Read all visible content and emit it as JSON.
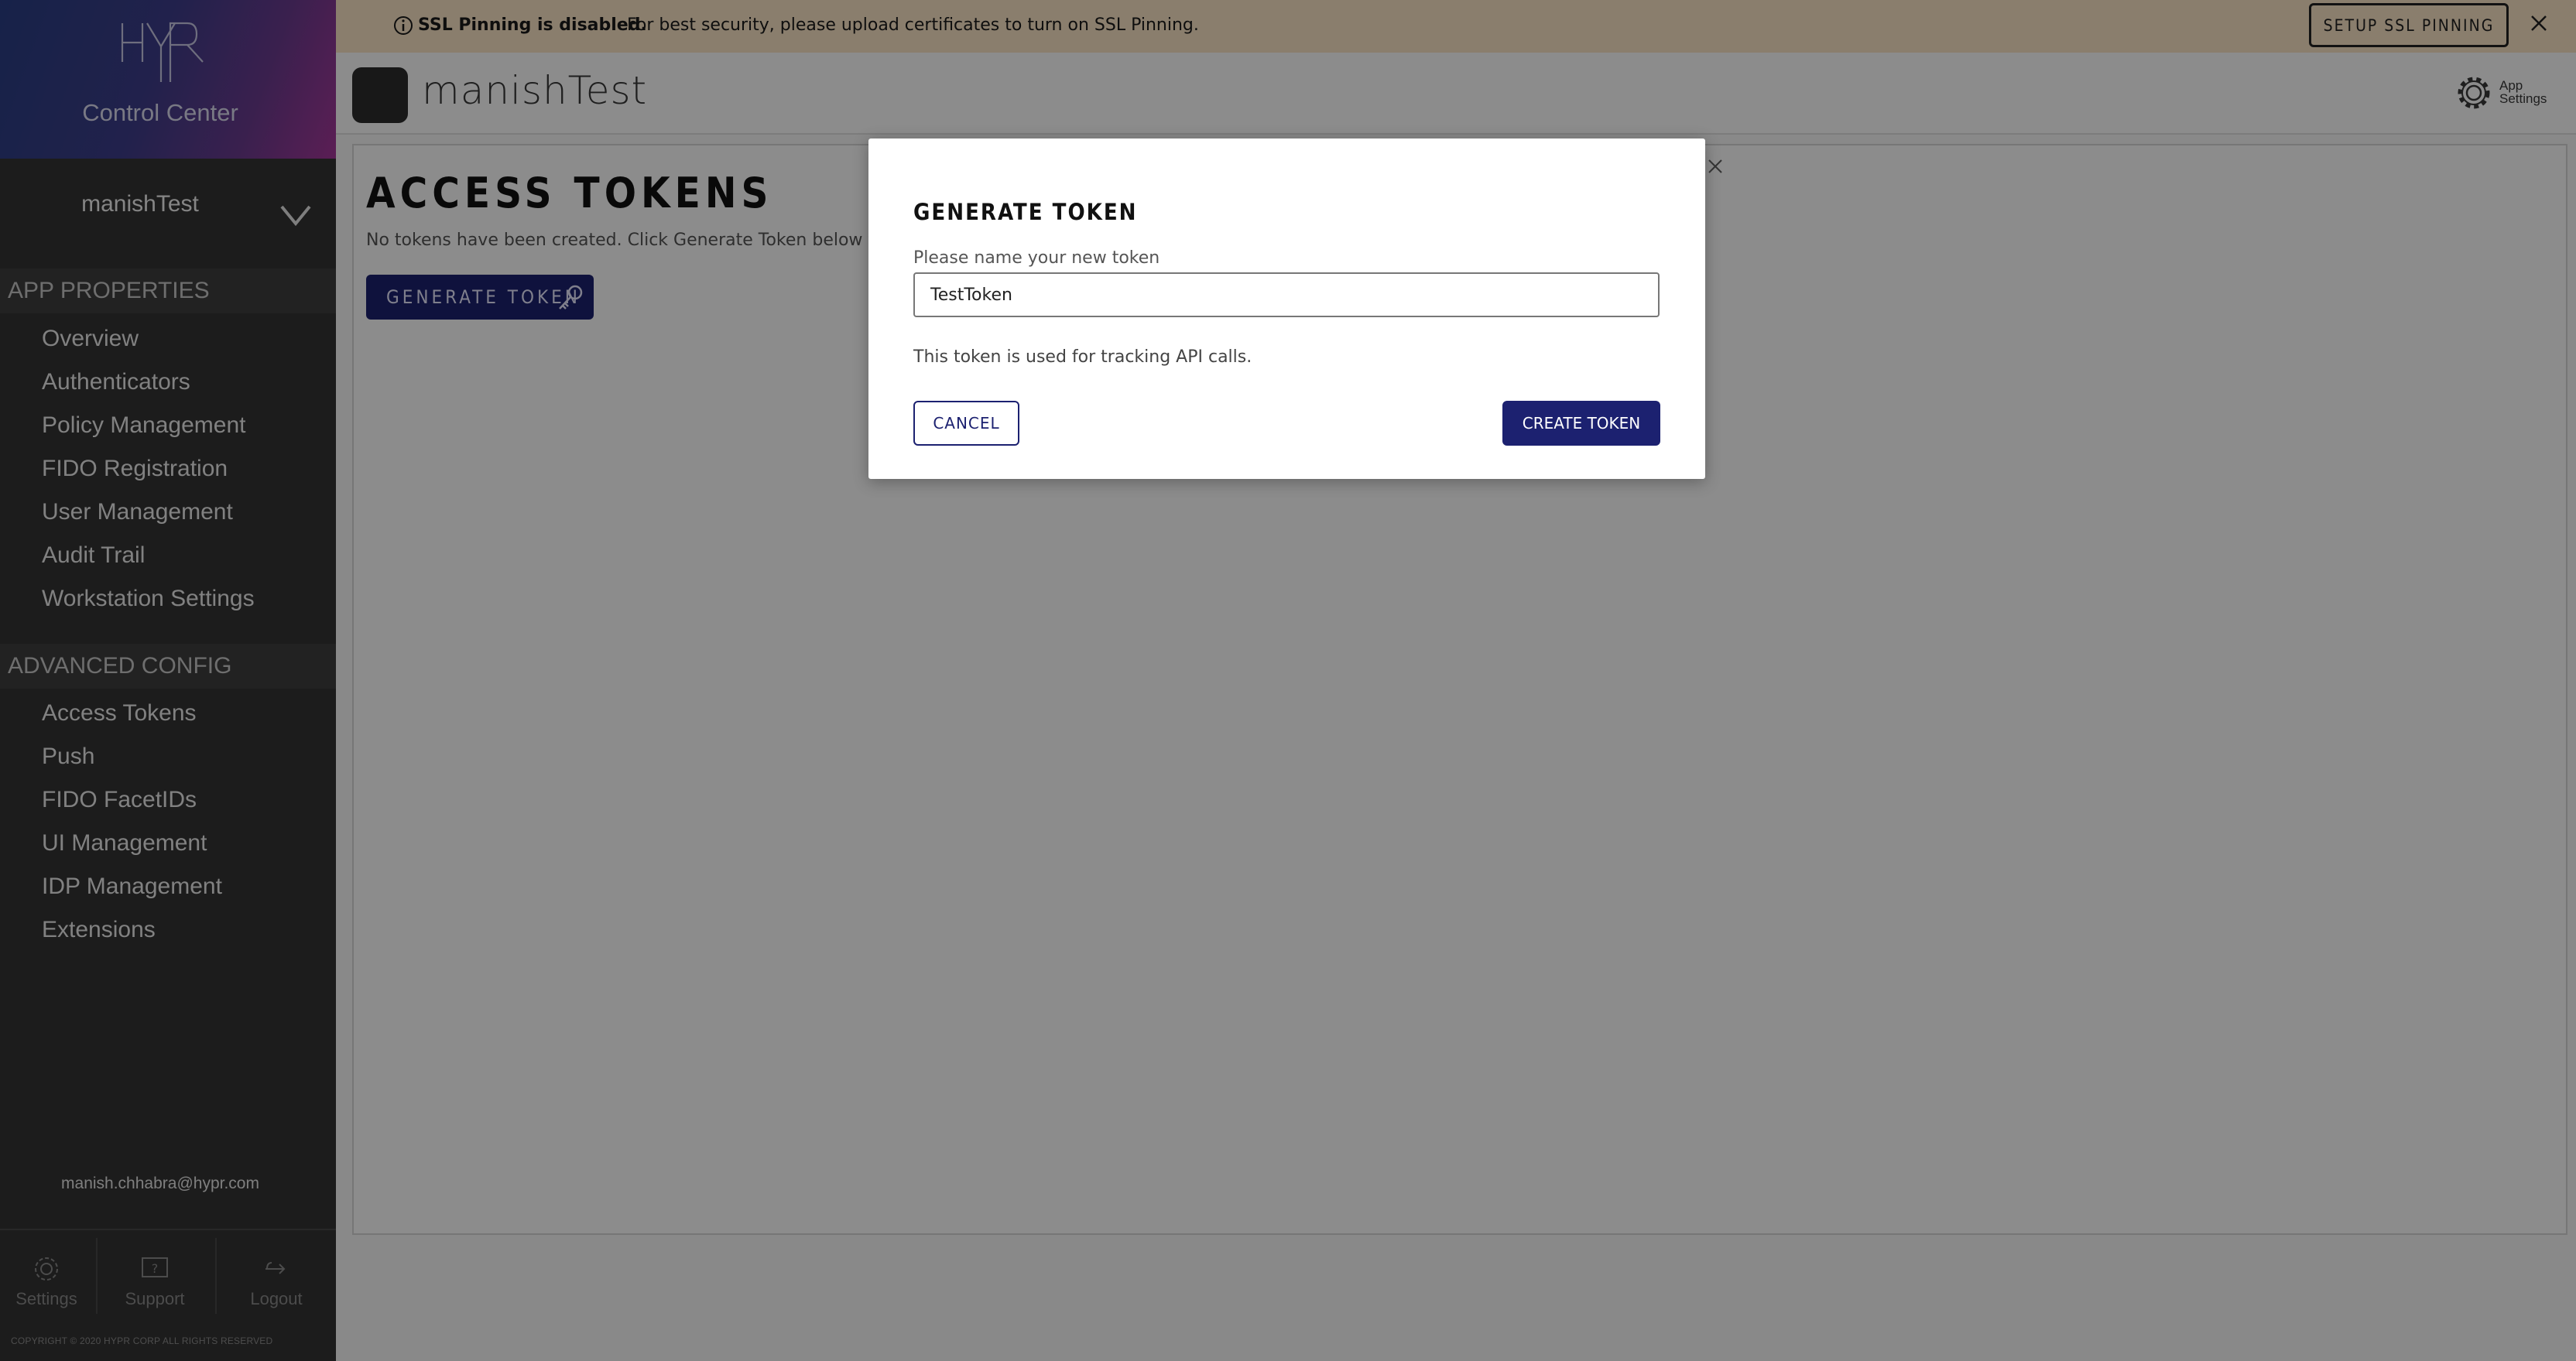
{
  "sidebar": {
    "brand_logo": "HYPR",
    "brand_title": "Control Center",
    "current_app": "manishTest",
    "sections": [
      {
        "title": "APP PROPERTIES",
        "items": [
          "Overview",
          "Authenticators",
          "Policy Management",
          "FIDO Registration",
          "User Management",
          "Audit Trail",
          "Workstation Settings"
        ]
      },
      {
        "title": "ADVANCED CONFIG",
        "items": [
          "Access Tokens",
          "Push",
          "FIDO FacetIDs",
          "UI Management",
          "IDP Management",
          "Extensions"
        ]
      }
    ],
    "user_email": "manish.chhabra@hypr.com",
    "footer": {
      "settings_label": "Settings",
      "support_label": "Support",
      "logout_label": "Logout"
    },
    "copyright": "COPYRIGHT © 2020 HYPR CORP ALL RIGHTS RESERVED"
  },
  "banner": {
    "bold_text": "SSL Pinning is disabled.",
    "message": "For best security, please upload certificates to turn on SSL Pinning.",
    "button_label": "SETUP SSL PINNING",
    "background": "#fbe5c6"
  },
  "header": {
    "app_name": "manishTest",
    "settings_label": "App Settings"
  },
  "main": {
    "title": "ACCESS TOKENS",
    "subtitle": "No tokens have been created. Click Generate Token below to cre",
    "generate_button": "GENERATE TOKEN"
  },
  "modal": {
    "title": "GENERATE TOKEN",
    "field_label": "Please name your new token",
    "input_value": "TestToken",
    "help_text": "This token is used for tracking API calls.",
    "cancel_label": "CANCEL",
    "create_label": "CREATE TOKEN"
  },
  "colors": {
    "primary": "#1c2170",
    "sidebar_bg": "#333333",
    "overlay": "rgba(0,0,0,0.45)"
  }
}
